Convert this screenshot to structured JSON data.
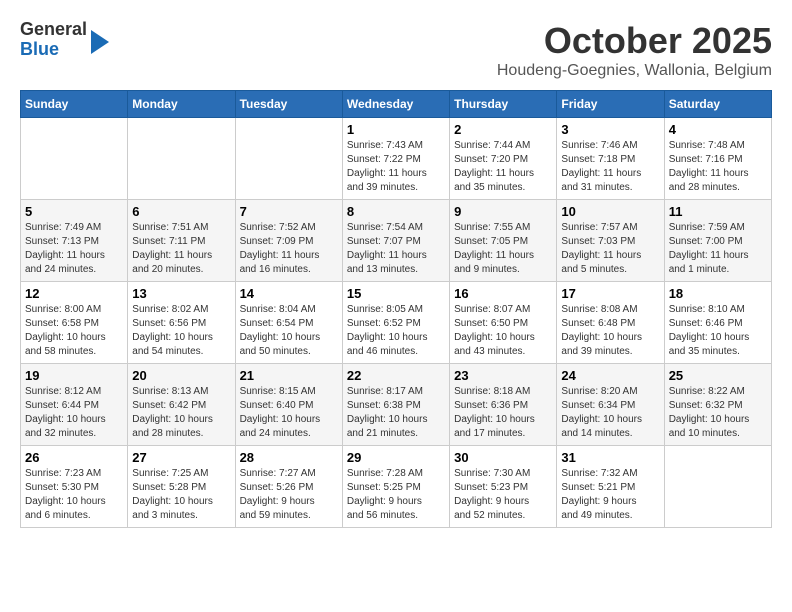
{
  "header": {
    "logo": {
      "line1": "General",
      "line2": "Blue"
    },
    "month": "October 2025",
    "location": "Houdeng-Goegnies, Wallonia, Belgium"
  },
  "weekdays": [
    "Sunday",
    "Monday",
    "Tuesday",
    "Wednesday",
    "Thursday",
    "Friday",
    "Saturday"
  ],
  "weeks": [
    [
      {
        "day": "",
        "info": ""
      },
      {
        "day": "",
        "info": ""
      },
      {
        "day": "",
        "info": ""
      },
      {
        "day": "1",
        "info": "Sunrise: 7:43 AM\nSunset: 7:22 PM\nDaylight: 11 hours\nand 39 minutes."
      },
      {
        "day": "2",
        "info": "Sunrise: 7:44 AM\nSunset: 7:20 PM\nDaylight: 11 hours\nand 35 minutes."
      },
      {
        "day": "3",
        "info": "Sunrise: 7:46 AM\nSunset: 7:18 PM\nDaylight: 11 hours\nand 31 minutes."
      },
      {
        "day": "4",
        "info": "Sunrise: 7:48 AM\nSunset: 7:16 PM\nDaylight: 11 hours\nand 28 minutes."
      }
    ],
    [
      {
        "day": "5",
        "info": "Sunrise: 7:49 AM\nSunset: 7:13 PM\nDaylight: 11 hours\nand 24 minutes."
      },
      {
        "day": "6",
        "info": "Sunrise: 7:51 AM\nSunset: 7:11 PM\nDaylight: 11 hours\nand 20 minutes."
      },
      {
        "day": "7",
        "info": "Sunrise: 7:52 AM\nSunset: 7:09 PM\nDaylight: 11 hours\nand 16 minutes."
      },
      {
        "day": "8",
        "info": "Sunrise: 7:54 AM\nSunset: 7:07 PM\nDaylight: 11 hours\nand 13 minutes."
      },
      {
        "day": "9",
        "info": "Sunrise: 7:55 AM\nSunset: 7:05 PM\nDaylight: 11 hours\nand 9 minutes."
      },
      {
        "day": "10",
        "info": "Sunrise: 7:57 AM\nSunset: 7:03 PM\nDaylight: 11 hours\nand 5 minutes."
      },
      {
        "day": "11",
        "info": "Sunrise: 7:59 AM\nSunset: 7:00 PM\nDaylight: 11 hours\nand 1 minute."
      }
    ],
    [
      {
        "day": "12",
        "info": "Sunrise: 8:00 AM\nSunset: 6:58 PM\nDaylight: 10 hours\nand 58 minutes."
      },
      {
        "day": "13",
        "info": "Sunrise: 8:02 AM\nSunset: 6:56 PM\nDaylight: 10 hours\nand 54 minutes."
      },
      {
        "day": "14",
        "info": "Sunrise: 8:04 AM\nSunset: 6:54 PM\nDaylight: 10 hours\nand 50 minutes."
      },
      {
        "day": "15",
        "info": "Sunrise: 8:05 AM\nSunset: 6:52 PM\nDaylight: 10 hours\nand 46 minutes."
      },
      {
        "day": "16",
        "info": "Sunrise: 8:07 AM\nSunset: 6:50 PM\nDaylight: 10 hours\nand 43 minutes."
      },
      {
        "day": "17",
        "info": "Sunrise: 8:08 AM\nSunset: 6:48 PM\nDaylight: 10 hours\nand 39 minutes."
      },
      {
        "day": "18",
        "info": "Sunrise: 8:10 AM\nSunset: 6:46 PM\nDaylight: 10 hours\nand 35 minutes."
      }
    ],
    [
      {
        "day": "19",
        "info": "Sunrise: 8:12 AM\nSunset: 6:44 PM\nDaylight: 10 hours\nand 32 minutes."
      },
      {
        "day": "20",
        "info": "Sunrise: 8:13 AM\nSunset: 6:42 PM\nDaylight: 10 hours\nand 28 minutes."
      },
      {
        "day": "21",
        "info": "Sunrise: 8:15 AM\nSunset: 6:40 PM\nDaylight: 10 hours\nand 24 minutes."
      },
      {
        "day": "22",
        "info": "Sunrise: 8:17 AM\nSunset: 6:38 PM\nDaylight: 10 hours\nand 21 minutes."
      },
      {
        "day": "23",
        "info": "Sunrise: 8:18 AM\nSunset: 6:36 PM\nDaylight: 10 hours\nand 17 minutes."
      },
      {
        "day": "24",
        "info": "Sunrise: 8:20 AM\nSunset: 6:34 PM\nDaylight: 10 hours\nand 14 minutes."
      },
      {
        "day": "25",
        "info": "Sunrise: 8:22 AM\nSunset: 6:32 PM\nDaylight: 10 hours\nand 10 minutes."
      }
    ],
    [
      {
        "day": "26",
        "info": "Sunrise: 7:23 AM\nSunset: 5:30 PM\nDaylight: 10 hours\nand 6 minutes."
      },
      {
        "day": "27",
        "info": "Sunrise: 7:25 AM\nSunset: 5:28 PM\nDaylight: 10 hours\nand 3 minutes."
      },
      {
        "day": "28",
        "info": "Sunrise: 7:27 AM\nSunset: 5:26 PM\nDaylight: 9 hours\nand 59 minutes."
      },
      {
        "day": "29",
        "info": "Sunrise: 7:28 AM\nSunset: 5:25 PM\nDaylight: 9 hours\nand 56 minutes."
      },
      {
        "day": "30",
        "info": "Sunrise: 7:30 AM\nSunset: 5:23 PM\nDaylight: 9 hours\nand 52 minutes."
      },
      {
        "day": "31",
        "info": "Sunrise: 7:32 AM\nSunset: 5:21 PM\nDaylight: 9 hours\nand 49 minutes."
      },
      {
        "day": "",
        "info": ""
      }
    ]
  ]
}
